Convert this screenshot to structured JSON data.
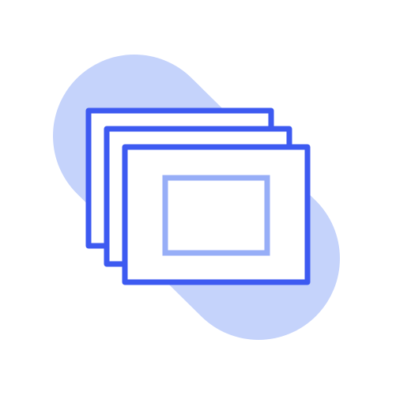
{
  "icon": {
    "name": "stacked-frames-icon",
    "layers": [
      "back-frame",
      "middle-frame",
      "front-frame",
      "inner-image-frame"
    ]
  },
  "colors": {
    "background": "#ffffff",
    "blob": "#c5d3fb",
    "frame_stroke": "#3d5af1",
    "frame_fill": "#ffffff",
    "inner_stroke": "#97aef7"
  }
}
